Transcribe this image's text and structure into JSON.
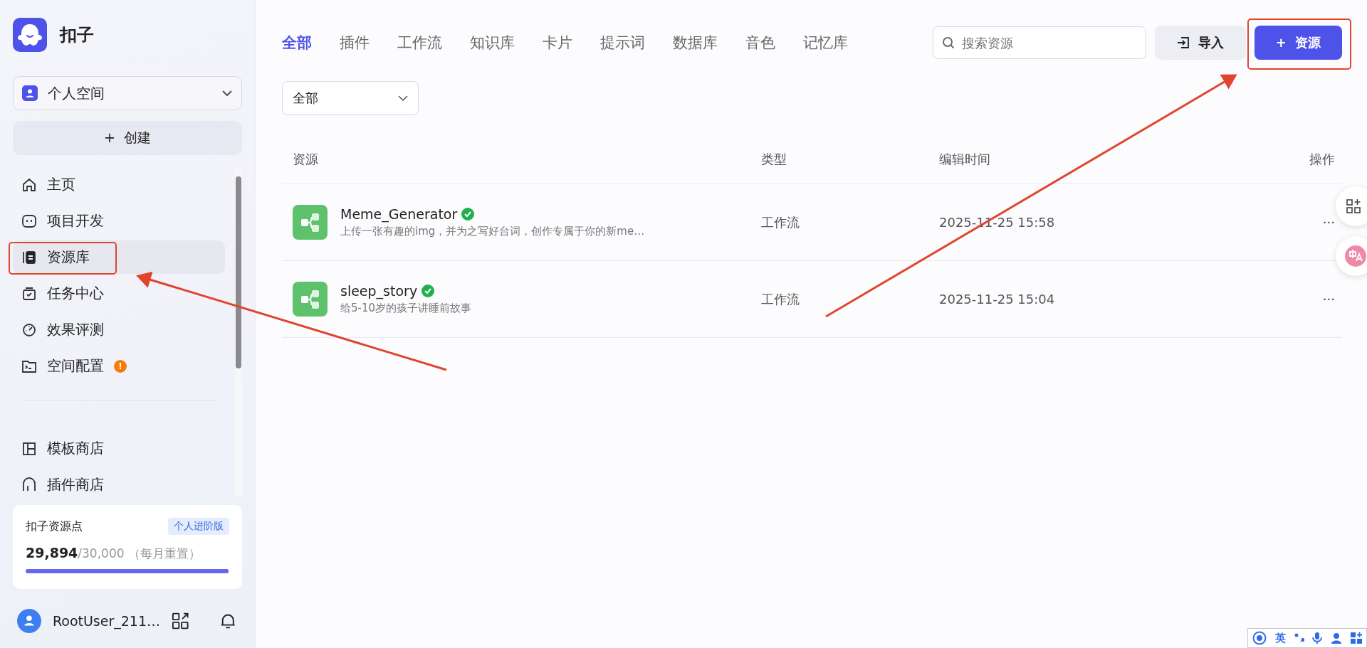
{
  "sidebar": {
    "brand": "扣子",
    "space": "个人空间",
    "create": {
      "icon": "+",
      "label": "创建"
    },
    "nav": [
      {
        "label": "主页",
        "selected": false
      },
      {
        "label": "项目开发",
        "selected": false
      },
      {
        "label": "资源库",
        "selected": true
      },
      {
        "label": "任务中心",
        "selected": false
      },
      {
        "label": "效果评测",
        "selected": false
      },
      {
        "label": "空间配置",
        "selected": false,
        "badge": "!"
      }
    ],
    "stores": [
      {
        "label": "模板商店"
      },
      {
        "label": "插件商店"
      }
    ],
    "points": {
      "title": "扣子资源点",
      "badge": "个人进阶版",
      "used": "29,894",
      "total": "/30,000",
      "note": "（每月重置）",
      "level": 0.9965
    },
    "user": {
      "name": "RootUser_211…"
    }
  },
  "tabs": [
    {
      "label": "全部",
      "selected": true
    },
    {
      "label": "插件",
      "selected": false
    },
    {
      "label": "工作流",
      "selected": false
    },
    {
      "label": "知识库",
      "selected": false
    },
    {
      "label": "卡片",
      "selected": false
    },
    {
      "label": "提示词",
      "selected": false
    },
    {
      "label": "数据库",
      "selected": false
    },
    {
      "label": "音色",
      "selected": false
    },
    {
      "label": "记忆库",
      "selected": false
    }
  ],
  "search": {
    "placeholder": "搜索资源"
  },
  "import_button": "导入",
  "add_button": {
    "icon": "+",
    "label": "资源"
  },
  "filter": "全部",
  "table": {
    "columns": [
      "资源",
      "类型",
      "编辑时间",
      "操作"
    ],
    "rows": [
      {
        "name": "Meme_Generator",
        "verified": true,
        "description": "上传一张有趣的img，并为之写好台词，创作专属于你的新me…",
        "type": "工作流",
        "time": "2025-11-25 15:58",
        "action": "···"
      },
      {
        "name": "sleep_story",
        "verified": true,
        "description": "给5-10岁的孩子讲睡前故事",
        "type": "工作流",
        "time": "2025-11-25 15:04",
        "action": "···"
      }
    ]
  },
  "ime_bar": {
    "label": "英"
  }
}
